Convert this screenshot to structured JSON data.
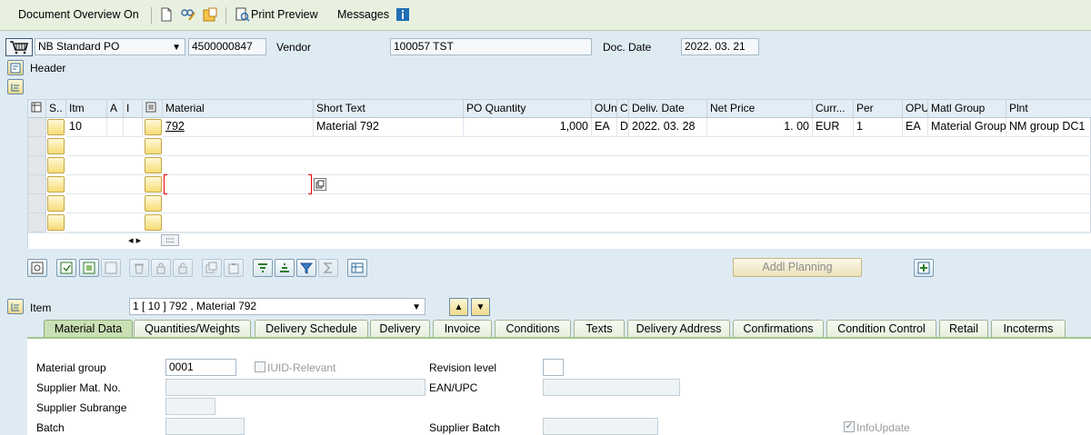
{
  "toolbar": {
    "doc_overview": "Document Overview On",
    "print_preview": "Print Preview",
    "messages": "Messages"
  },
  "header": {
    "po_type": "NB Standard PO",
    "po_number": "4500000847",
    "vendor_label": "Vendor",
    "vendor_value": "100057 TST",
    "doc_date_label": "Doc. Date",
    "doc_date_value": "2022. 03. 21",
    "header_label": "Header"
  },
  "table": {
    "columns": [
      "S..",
      "Itm",
      "A",
      "I",
      "Material",
      "Short Text",
      "PO Quantity",
      "OUn",
      "C",
      "Deliv. Date",
      "Net Price",
      "Curr...",
      "Per",
      "OPU",
      "Matl Group",
      "Plnt"
    ],
    "rows": [
      {
        "itm": "10",
        "material": "792",
        "short_text": "Material 792",
        "po_qty": "1,000",
        "oun": "EA",
        "c": "D",
        "deliv_date": "2022. 03. 28",
        "net_price": "1. 00",
        "curr": "EUR",
        "per": "1",
        "opu": "EA",
        "matl_group": "Material Group..",
        "plnt": "NM group DC1"
      }
    ],
    "nav_arrows": "◂ ▸",
    "scroll_handle": "::::"
  },
  "buttons": {
    "addl_planning": "Addl Planning"
  },
  "item": {
    "label": "Item",
    "selected": "1 [ 10 ] 792 , Material 792"
  },
  "tabs": [
    "Material Data",
    "Quantities/Weights",
    "Delivery Schedule",
    "Delivery",
    "Invoice",
    "Conditions",
    "Texts",
    "Delivery Address",
    "Confirmations",
    "Condition Control",
    "Retail",
    "Incoterms"
  ],
  "material_data": {
    "material_group_label": "Material group",
    "material_group_value": "0001",
    "iuid_label": "IUID-Relevant",
    "revision_label": "Revision level",
    "supplier_mat_label": "Supplier Mat. No.",
    "ean_label": "EAN/UPC",
    "supplier_subrange_label": "Supplier Subrange",
    "batch_label": "Batch",
    "supplier_batch_label": "Supplier Batch",
    "infoupdate_label": "InfoUpdate"
  },
  "colors": {
    "accent_blue": "#1f6fb5",
    "tab_active": "#c9e0b4",
    "panel_border": "#a4c48b"
  }
}
